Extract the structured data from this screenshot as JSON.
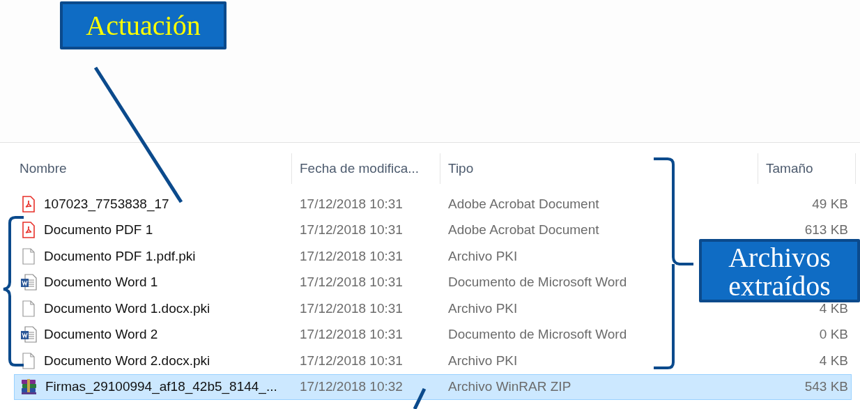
{
  "columns": [
    {
      "label": "Nombre"
    },
    {
      "label": "Fecha de modifica..."
    },
    {
      "label": "Tipo"
    },
    {
      "label": "Tamaño"
    }
  ],
  "rows": [
    {
      "kind": "pdf",
      "name": "107023_7753838_17",
      "date": "17/12/2018 10:31",
      "type": "Adobe Acrobat Document",
      "size": "49 KB",
      "selected": false
    },
    {
      "kind": "pdf",
      "name": "Documento PDF 1",
      "date": "17/12/2018 10:31",
      "type": "Adobe Acrobat Document",
      "size": "613 KB",
      "selected": false
    },
    {
      "kind": "blank",
      "name": "Documento PDF 1.pdf.pki",
      "date": "17/12/2018 10:31",
      "type": "Archivo PKI",
      "selected": false
    },
    {
      "kind": "word",
      "name": "Documento Word 1",
      "date": "17/12/2018 10:31",
      "type": "Documento de Microsoft Word",
      "selected": false
    },
    {
      "kind": "blank",
      "name": "Documento Word 1.docx.pki",
      "date": "17/12/2018 10:31",
      "type": "Archivo PKI",
      "size": "4 KB",
      "selected": false
    },
    {
      "kind": "word",
      "name": "Documento Word 2",
      "date": "17/12/2018 10:31",
      "type": "Documento de Microsoft Word",
      "size": "0 KB",
      "selected": false
    },
    {
      "kind": "blank",
      "name": "Documento Word 2.docx.pki",
      "date": "17/12/2018 10:31",
      "type": "Archivo PKI",
      "size": "4 KB",
      "selected": false
    },
    {
      "kind": "archive",
      "name": "Firmas_29100994_af18_42b5_8144_...",
      "date": "17/12/2018 10:32",
      "type": "Archivo WinRAR ZIP",
      "size": "543 KB",
      "selected": true
    }
  ],
  "callouts": [
    {
      "kind": "top",
      "text": "Actuación"
    },
    {
      "kind": "side",
      "text": "Archivos extraídos"
    }
  ]
}
